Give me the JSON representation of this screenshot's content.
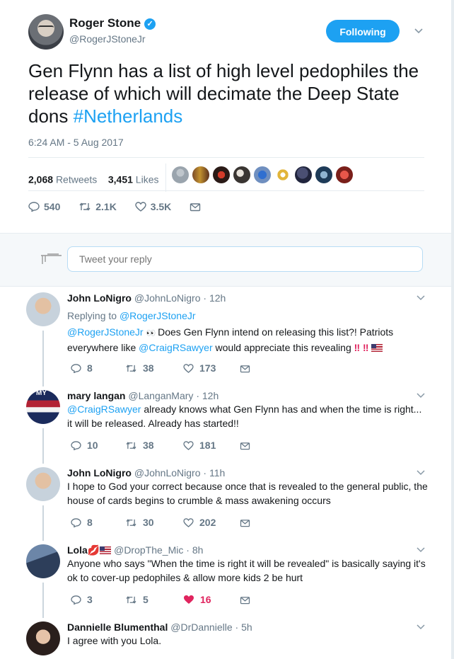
{
  "tweet": {
    "author_name": "Roger Stone",
    "author_handle": "@RogerJStoneJr",
    "follow_label": "Following",
    "text_plain": "Gen Flynn has a list of high level pedophiles the release of which will decimate the Deep State dons ",
    "hashtag": "#Netherlands",
    "timestamp": "6:24 AM - 5 Aug 2017",
    "retweets_count": "2,068",
    "retweets_label": "Retweets",
    "likes_count": "3,451",
    "likes_label": "Likes",
    "reply_count": "540",
    "retweet_count_short": "2.1K",
    "like_count_short": "3.5K"
  },
  "reply_composer": {
    "placeholder": "Tweet your reply"
  },
  "colors": {
    "accent": "#1da1f2",
    "liked": "#e0245e",
    "muted": "#657786"
  },
  "replies": [
    {
      "name": "John LoNigro",
      "handle": "@JohnLoNigro",
      "time": "12h",
      "replying_to_prefix": "Replying to ",
      "replying_to": "@RogerJStoneJr",
      "mention1": "@RogerJStoneJr",
      "text1": " Does Gen Flynn intend on releasing this list?! Patriots everywhere like ",
      "mention2": "@CraigRSawyer",
      "text2": " would appreciate this revealing ",
      "reply_count": "8",
      "retweet_count": "38",
      "like_count": "173"
    },
    {
      "name": "mary langan",
      "handle": "@LanganMary",
      "time": "12h",
      "avatar_text": "MY",
      "mention1": "@CraigRSawyer",
      "text1": " already knows what Gen Flynn has and when the time is right... it will be released. Already has started!!",
      "reply_count": "10",
      "retweet_count": "38",
      "like_count": "181"
    },
    {
      "name": "John LoNigro",
      "handle": "@JohnLoNigro",
      "time": "11h",
      "text1": "I hope to God your correct because once that is revealed to the general public, the house of cards begins to crumble & mass awakening occurs",
      "reply_count": "8",
      "retweet_count": "30",
      "like_count": "202"
    },
    {
      "name": "Lola",
      "handle": "@DropThe_Mic",
      "time": "8h",
      "text1": "Anyone who says \"When the time is right it will be revealed\" is basically saying it's ok to cover-up pedophiles & allow more kids 2 be hurt",
      "reply_count": "3",
      "retweet_count": "5",
      "like_count": "16"
    },
    {
      "name": "Dannielle Blumenthal",
      "handle": "@DrDannielle",
      "time": "5h",
      "text1": "I agree with you Lola."
    }
  ]
}
